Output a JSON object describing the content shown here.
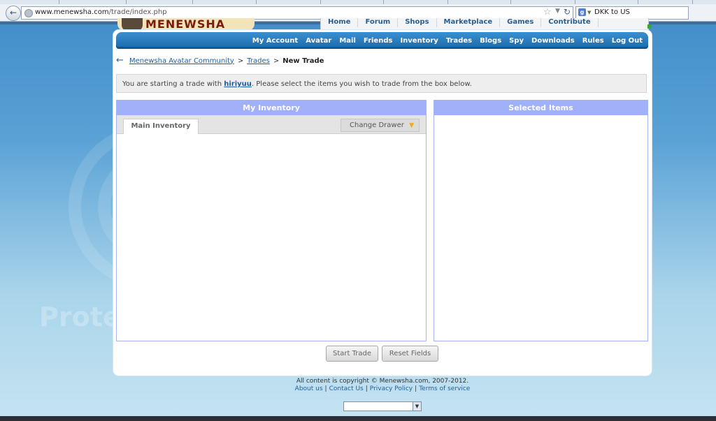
{
  "browser": {
    "url_host": "www.menewsha.com",
    "url_path": "/trade/index.php",
    "search_text": "DKK to US",
    "google_icon_letter": "g"
  },
  "site": {
    "logo_text": "MENEWSHA",
    "top_nav": [
      "Home",
      "Forum",
      "Shops",
      "Marketplace",
      "Games",
      "Contribute"
    ],
    "menu": [
      "My Account",
      "Avatar",
      "Mail",
      "Friends",
      "Inventory",
      "Trades",
      "Blogs",
      "Spy",
      "Downloads",
      "Rules",
      "Log Out"
    ]
  },
  "breadcrumb": {
    "home": "Menewsha Avatar Community",
    "section": "Trades",
    "current": "New Trade",
    "separator": ">"
  },
  "notice": {
    "prefix": "You are starting a trade with ",
    "user": "hiriyuu",
    "suffix": ". Please select the items you wish to trade from the box below."
  },
  "inventory_panel": {
    "title": "My Inventory",
    "tab_label": "Main Inventory",
    "drawer_button": "Change Drawer"
  },
  "selected_panel": {
    "title": "Selected Items"
  },
  "buttons": {
    "start": "Start Trade",
    "reset": "Reset Fields"
  },
  "footer": {
    "copyright": "All content is copyright © Menewsha.com, 2007-2012.",
    "links": [
      "About us",
      "Contact Us",
      "Privacy Policy",
      "Terms of service"
    ]
  },
  "background_text": "Prote",
  "colors": {
    "menu_blue": "#1c6aaa",
    "panel_header": "#a0b1fa",
    "link": "#1f5fa0",
    "drawer_arrow": "#f2a81c"
  }
}
